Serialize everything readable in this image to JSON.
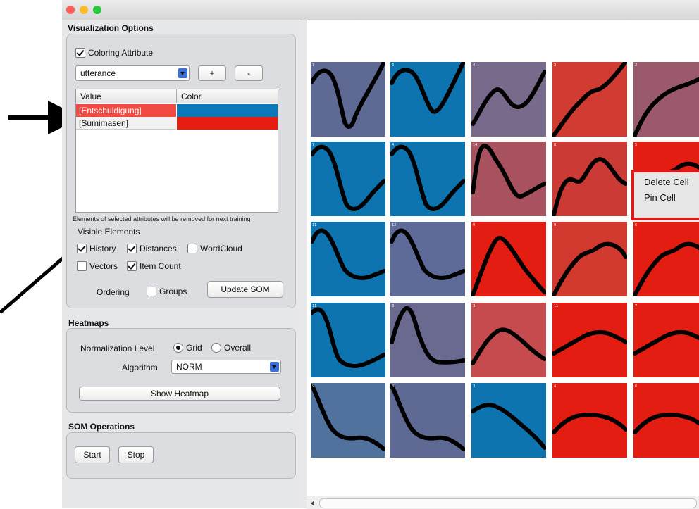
{
  "window": {
    "traffic_lights": {
      "close": "#fd5f57",
      "minimize": "#febb2e",
      "maximize": "#29c840"
    }
  },
  "visualization_options": {
    "title": "Visualization Options",
    "coloring_attribute_label": "Coloring Attribute",
    "coloring_attribute_checked": true,
    "attribute_select": "utterance",
    "add_label": "+",
    "remove_label": "-",
    "table": {
      "headers": [
        "Value",
        "Color"
      ],
      "rows": [
        {
          "value": "[Entschuldigung]",
          "color": "#0a78b9",
          "selected": true
        },
        {
          "value": "[Sumimasen]",
          "color": "#e61e12",
          "selected": false
        }
      ]
    },
    "note": "Elements of selected attributes will be removed for next training",
    "visible_elements_title": "Visible Elements",
    "history_label": "History",
    "history_checked": true,
    "distances_label": "Distances",
    "distances_checked": true,
    "wordcloud_label": "WordCloud",
    "wordcloud_checked": false,
    "vectors_label": "Vectors",
    "vectors_checked": false,
    "item_count_label": "Item Count",
    "item_count_checked": true,
    "ordering_label": "Ordering",
    "groups_label": "Groups",
    "groups_checked": false,
    "update_som_label": "Update SOM"
  },
  "heatmaps": {
    "title": "Heatmaps",
    "normalization_label": "Normalization Level",
    "grid_label": "Grid",
    "grid_selected": true,
    "overall_label": "Overall",
    "overall_selected": false,
    "algorithm_label": "Algorithm",
    "algorithm_select": "NORM",
    "show_heatmap_label": "Show Heatmap"
  },
  "som_operations": {
    "title": "SOM Operations",
    "start_label": "Start",
    "stop_label": "Stop"
  },
  "context_menu": {
    "items": [
      "Delete Cell",
      "Pin Cell"
    ]
  },
  "som_grid": {
    "cells": [
      {
        "color": "#5f6a94",
        "count": "7",
        "curve": "vee"
      },
      {
        "color": "#0d74b0",
        "count": "6",
        "curve": "vee2"
      },
      {
        "color": "#786a8a",
        "count": "4",
        "curve": "wave"
      },
      {
        "color": "#d03b32",
        "count": "3",
        "curve": "rise"
      },
      {
        "color": "#9a5a6c",
        "count": "2",
        "curve": "rise2"
      },
      {
        "color": "#0d74b0",
        "count": "7",
        "curve": "dip"
      },
      {
        "color": "#0d74b0",
        "count": "4",
        "curve": "dip"
      },
      {
        "color": "#a8525f",
        "count": "14",
        "curve": "fall"
      },
      {
        "color": "#cc3a35",
        "count": "8",
        "curve": "stair"
      },
      {
        "color": "#e41d13",
        "count": "5",
        "curve": "hump"
      },
      {
        "color": "#0d74b0",
        "count": "11",
        "curve": "dropmid"
      },
      {
        "color": "#5e6a98",
        "count": "12",
        "curve": "dropmid"
      },
      {
        "color": "#e41d13",
        "count": "9",
        "curve": "peak"
      },
      {
        "color": "#d2392f",
        "count": "9",
        "curve": "hump"
      },
      {
        "color": "#e41d13",
        "count": "6",
        "curve": "hump"
      },
      {
        "color": "#0d74b0",
        "count": "11",
        "curve": "drop"
      },
      {
        "color": "#6a6a90",
        "count": "3",
        "curve": "peakdrop"
      },
      {
        "color": "#c54b4e",
        "count": "3",
        "curve": "hump2"
      },
      {
        "color": "#e41d13",
        "count": "11",
        "curve": "flat"
      },
      {
        "color": "#e41d13",
        "count": "7",
        "curve": "flat"
      },
      {
        "color": "#52729e",
        "count": "9",
        "curve": "declinewave"
      },
      {
        "color": "#5e6a94",
        "count": "3",
        "curve": "declinewave"
      },
      {
        "color": "#0d74b0",
        "count": "3",
        "curve": "slope"
      },
      {
        "color": "#e41d13",
        "count": "4",
        "curve": "flatdown"
      },
      {
        "color": "#e41d13",
        "count": "6",
        "curve": "flatdown"
      }
    ]
  }
}
